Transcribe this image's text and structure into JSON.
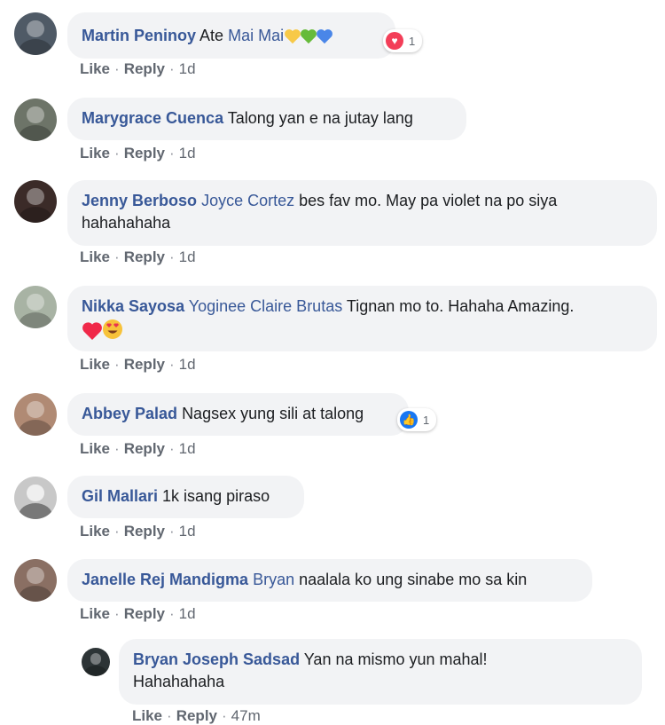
{
  "comments": [
    {
      "author": "Martin Peninoy",
      "text": "Ate",
      "mention": "Mai Mai",
      "hearts": [
        "#f7c948",
        "#66bb3a",
        "#4a86e8"
      ],
      "reaction": {
        "type": "love",
        "count": "1",
        "color": "#f33e58"
      },
      "like": "Like",
      "reply": "Reply",
      "time": "1d",
      "avatar_color": "#4f5a66"
    },
    {
      "author": "Marygrace Cuenca",
      "text": "Talong yan e na jutay lang",
      "like": "Like",
      "reply": "Reply",
      "time": "1d",
      "avatar_color": "#6d7468"
    },
    {
      "author": "Jenny Berboso",
      "mention": "Joyce Cortez",
      "text": "bes fav mo. May pa violet na po siya",
      "text2": "hahahahaha",
      "like": "Like",
      "reply": "Reply",
      "time": "1d",
      "avatar_color": "#3b2b28"
    },
    {
      "author": "Nikka Sayosa",
      "mention": "Yoginee Claire Brutas",
      "text": "Tignan mo to. Hahaha Amazing.",
      "emoji_red_heart": "#f02849",
      "emoji_heart_eyes": "😍",
      "like": "Like",
      "reply": "Reply",
      "time": "1d",
      "avatar_color": "#a8b3a4"
    },
    {
      "author": "Abbey Palad",
      "text": "Nagsex yung sili at talong",
      "reaction": {
        "type": "like",
        "count": "1",
        "color": "#1877f2"
      },
      "like": "Like",
      "reply": "Reply",
      "time": "1d",
      "avatar_color": "#b08a74"
    },
    {
      "author": "Gil Mallari",
      "text": "1k isang piraso",
      "like": "Like",
      "reply": "Reply",
      "time": "1d",
      "avatar_color": "#c8c8c8"
    },
    {
      "author": "Janelle Rej Mandigma",
      "mention": "Bryan",
      "text": "naalala ko ung sinabe mo sa kin",
      "like": "Like",
      "reply": "Reply",
      "time": "1d",
      "avatar_color": "#8a6f63"
    },
    {
      "author": "Bryan Joseph Sadsad",
      "text": "Yan na mismo yun mahal!",
      "text2": "Hahahahaha",
      "like": "Like",
      "reply": "Reply",
      "time": "47m",
      "avatar_color": "#2d3436"
    }
  ]
}
